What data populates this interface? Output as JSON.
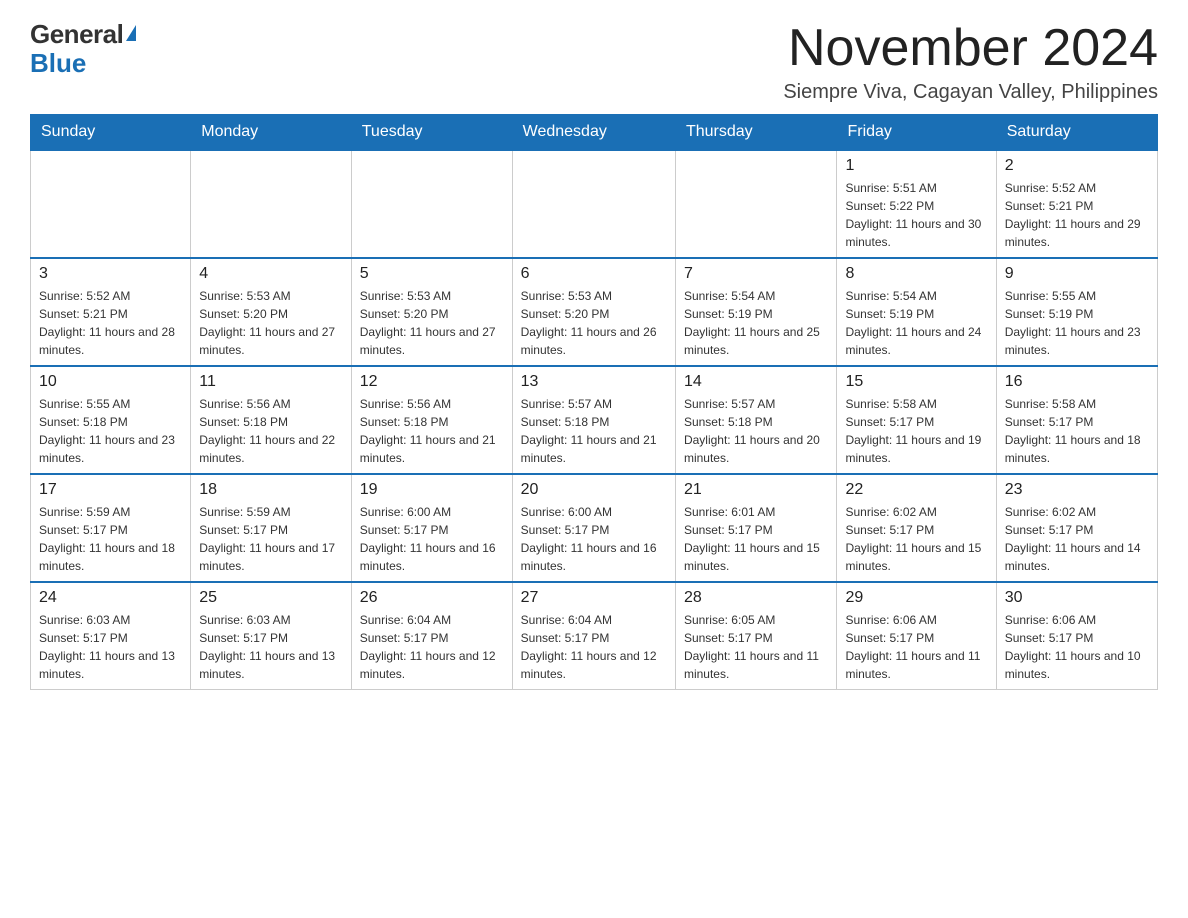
{
  "header": {
    "logo_general": "General",
    "logo_blue": "Blue",
    "month_year": "November 2024",
    "location": "Siempre Viva, Cagayan Valley, Philippines"
  },
  "days_of_week": [
    "Sunday",
    "Monday",
    "Tuesday",
    "Wednesday",
    "Thursday",
    "Friday",
    "Saturday"
  ],
  "weeks": [
    {
      "days": [
        {
          "number": "",
          "info": "",
          "empty": true
        },
        {
          "number": "",
          "info": "",
          "empty": true
        },
        {
          "number": "",
          "info": "",
          "empty": true
        },
        {
          "number": "",
          "info": "",
          "empty": true
        },
        {
          "number": "",
          "info": "",
          "empty": true
        },
        {
          "number": "1",
          "info": "Sunrise: 5:51 AM\nSunset: 5:22 PM\nDaylight: 11 hours and 30 minutes.",
          "empty": false
        },
        {
          "number": "2",
          "info": "Sunrise: 5:52 AM\nSunset: 5:21 PM\nDaylight: 11 hours and 29 minutes.",
          "empty": false
        }
      ]
    },
    {
      "days": [
        {
          "number": "3",
          "info": "Sunrise: 5:52 AM\nSunset: 5:21 PM\nDaylight: 11 hours and 28 minutes.",
          "empty": false
        },
        {
          "number": "4",
          "info": "Sunrise: 5:53 AM\nSunset: 5:20 PM\nDaylight: 11 hours and 27 minutes.",
          "empty": false
        },
        {
          "number": "5",
          "info": "Sunrise: 5:53 AM\nSunset: 5:20 PM\nDaylight: 11 hours and 27 minutes.",
          "empty": false
        },
        {
          "number": "6",
          "info": "Sunrise: 5:53 AM\nSunset: 5:20 PM\nDaylight: 11 hours and 26 minutes.",
          "empty": false
        },
        {
          "number": "7",
          "info": "Sunrise: 5:54 AM\nSunset: 5:19 PM\nDaylight: 11 hours and 25 minutes.",
          "empty": false
        },
        {
          "number": "8",
          "info": "Sunrise: 5:54 AM\nSunset: 5:19 PM\nDaylight: 11 hours and 24 minutes.",
          "empty": false
        },
        {
          "number": "9",
          "info": "Sunrise: 5:55 AM\nSunset: 5:19 PM\nDaylight: 11 hours and 23 minutes.",
          "empty": false
        }
      ]
    },
    {
      "days": [
        {
          "number": "10",
          "info": "Sunrise: 5:55 AM\nSunset: 5:18 PM\nDaylight: 11 hours and 23 minutes.",
          "empty": false
        },
        {
          "number": "11",
          "info": "Sunrise: 5:56 AM\nSunset: 5:18 PM\nDaylight: 11 hours and 22 minutes.",
          "empty": false
        },
        {
          "number": "12",
          "info": "Sunrise: 5:56 AM\nSunset: 5:18 PM\nDaylight: 11 hours and 21 minutes.",
          "empty": false
        },
        {
          "number": "13",
          "info": "Sunrise: 5:57 AM\nSunset: 5:18 PM\nDaylight: 11 hours and 21 minutes.",
          "empty": false
        },
        {
          "number": "14",
          "info": "Sunrise: 5:57 AM\nSunset: 5:18 PM\nDaylight: 11 hours and 20 minutes.",
          "empty": false
        },
        {
          "number": "15",
          "info": "Sunrise: 5:58 AM\nSunset: 5:17 PM\nDaylight: 11 hours and 19 minutes.",
          "empty": false
        },
        {
          "number": "16",
          "info": "Sunrise: 5:58 AM\nSunset: 5:17 PM\nDaylight: 11 hours and 18 minutes.",
          "empty": false
        }
      ]
    },
    {
      "days": [
        {
          "number": "17",
          "info": "Sunrise: 5:59 AM\nSunset: 5:17 PM\nDaylight: 11 hours and 18 minutes.",
          "empty": false
        },
        {
          "number": "18",
          "info": "Sunrise: 5:59 AM\nSunset: 5:17 PM\nDaylight: 11 hours and 17 minutes.",
          "empty": false
        },
        {
          "number": "19",
          "info": "Sunrise: 6:00 AM\nSunset: 5:17 PM\nDaylight: 11 hours and 16 minutes.",
          "empty": false
        },
        {
          "number": "20",
          "info": "Sunrise: 6:00 AM\nSunset: 5:17 PM\nDaylight: 11 hours and 16 minutes.",
          "empty": false
        },
        {
          "number": "21",
          "info": "Sunrise: 6:01 AM\nSunset: 5:17 PM\nDaylight: 11 hours and 15 minutes.",
          "empty": false
        },
        {
          "number": "22",
          "info": "Sunrise: 6:02 AM\nSunset: 5:17 PM\nDaylight: 11 hours and 15 minutes.",
          "empty": false
        },
        {
          "number": "23",
          "info": "Sunrise: 6:02 AM\nSunset: 5:17 PM\nDaylight: 11 hours and 14 minutes.",
          "empty": false
        }
      ]
    },
    {
      "days": [
        {
          "number": "24",
          "info": "Sunrise: 6:03 AM\nSunset: 5:17 PM\nDaylight: 11 hours and 13 minutes.",
          "empty": false
        },
        {
          "number": "25",
          "info": "Sunrise: 6:03 AM\nSunset: 5:17 PM\nDaylight: 11 hours and 13 minutes.",
          "empty": false
        },
        {
          "number": "26",
          "info": "Sunrise: 6:04 AM\nSunset: 5:17 PM\nDaylight: 11 hours and 12 minutes.",
          "empty": false
        },
        {
          "number": "27",
          "info": "Sunrise: 6:04 AM\nSunset: 5:17 PM\nDaylight: 11 hours and 12 minutes.",
          "empty": false
        },
        {
          "number": "28",
          "info": "Sunrise: 6:05 AM\nSunset: 5:17 PM\nDaylight: 11 hours and 11 minutes.",
          "empty": false
        },
        {
          "number": "29",
          "info": "Sunrise: 6:06 AM\nSunset: 5:17 PM\nDaylight: 11 hours and 11 minutes.",
          "empty": false
        },
        {
          "number": "30",
          "info": "Sunrise: 6:06 AM\nSunset: 5:17 PM\nDaylight: 11 hours and 10 minutes.",
          "empty": false
        }
      ]
    }
  ]
}
